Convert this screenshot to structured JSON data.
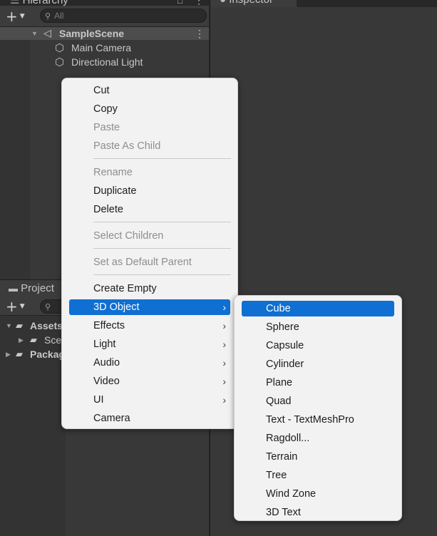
{
  "hierarchy": {
    "tab_title": "Hierarchy",
    "search_placeholder": "All",
    "scene_name": "SampleScene",
    "objects": [
      "Main Camera",
      "Directional Light"
    ]
  },
  "inspector": {
    "tab_title": "Inspector"
  },
  "project": {
    "tab_title": "Project",
    "tree": [
      "Assets",
      "Scenes",
      "Packages"
    ]
  },
  "context_menu": {
    "items": [
      {
        "label": "Cut",
        "enabled": true
      },
      {
        "label": "Copy",
        "enabled": true
      },
      {
        "label": "Paste",
        "enabled": false
      },
      {
        "label": "Paste As Child",
        "enabled": false
      },
      {
        "label": "Rename",
        "enabled": false
      },
      {
        "label": "Duplicate",
        "enabled": true
      },
      {
        "label": "Delete",
        "enabled": true
      },
      {
        "label": "Select Children",
        "enabled": false
      },
      {
        "label": "Set as Default Parent",
        "enabled": false
      },
      {
        "label": "Create Empty",
        "enabled": true
      },
      {
        "label": "3D Object",
        "enabled": true,
        "submenu": true,
        "selected": true
      },
      {
        "label": "Effects",
        "enabled": true,
        "submenu": true
      },
      {
        "label": "Light",
        "enabled": true,
        "submenu": true
      },
      {
        "label": "Audio",
        "enabled": true,
        "submenu": true
      },
      {
        "label": "Video",
        "enabled": true,
        "submenu": true
      },
      {
        "label": "UI",
        "enabled": true,
        "submenu": true
      },
      {
        "label": "Camera",
        "enabled": true
      }
    ]
  },
  "submenu_3d_object": {
    "items": [
      "Cube",
      "Sphere",
      "Capsule",
      "Cylinder",
      "Plane",
      "Quad",
      "Text - TextMeshPro",
      "Ragdoll...",
      "Terrain",
      "Tree",
      "Wind Zone",
      "3D Text"
    ],
    "selected": "Cube"
  },
  "colors": {
    "selection": "#0f6fd2",
    "panel": "#383838",
    "menu_bg": "#f2f2f2"
  }
}
